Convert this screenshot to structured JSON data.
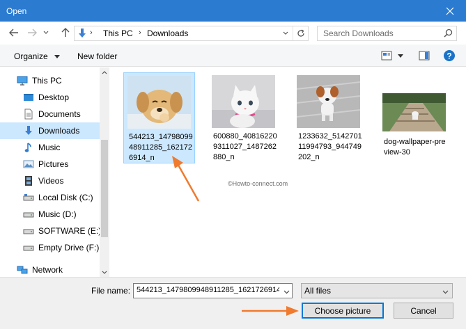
{
  "window": {
    "title": "Open"
  },
  "address": {
    "crumbs": [
      "This PC",
      "Downloads"
    ],
    "search_placeholder": "Search Downloads"
  },
  "toolbar": {
    "organize": "Organize",
    "new_folder": "New folder"
  },
  "nav": {
    "items": [
      {
        "label": "This PC",
        "icon": "monitor-icon",
        "selected": false
      },
      {
        "label": "Desktop",
        "icon": "desktop-folder-icon",
        "selected": false
      },
      {
        "label": "Documents",
        "icon": "documents-icon",
        "selected": false
      },
      {
        "label": "Downloads",
        "icon": "download-arrow-icon",
        "selected": true
      },
      {
        "label": "Music",
        "icon": "music-note-icon",
        "selected": false
      },
      {
        "label": "Pictures",
        "icon": "pictures-icon",
        "selected": false
      },
      {
        "label": "Videos",
        "icon": "film-icon",
        "selected": false
      },
      {
        "label": "Local Disk (C:)",
        "icon": "drive-icon",
        "selected": false
      },
      {
        "label": "Music (D:)",
        "icon": "drive-icon",
        "selected": false
      },
      {
        "label": "SOFTWARE (E:)",
        "icon": "drive-icon",
        "selected": false
      },
      {
        "label": "Empty Drive (F:)",
        "icon": "drive-icon",
        "selected": false
      },
      {
        "label": "Network",
        "icon": "network-icon",
        "selected": false
      }
    ]
  },
  "files": [
    {
      "name": "544213_1479809948911285_1621726914_n",
      "thumb": "puppy-laughing",
      "selected": true
    },
    {
      "name": "600880_408162209311027_1487262880_n",
      "thumb": "white-kitten",
      "selected": false
    },
    {
      "name": "1233632_514270111994793_944749202_n",
      "thumb": "puppy-on-floor",
      "selected": false
    },
    {
      "name": "dog-wallpaper-preview-30",
      "thumb": "dog-on-path",
      "selected": false
    }
  ],
  "watermark": "©Howto-connect.com",
  "footer": {
    "file_name_label": "File name:",
    "file_name_value": "544213_1479809948911285_1621726914_",
    "filter_value": "All files",
    "choose_label": "Choose picture",
    "cancel_label": "Cancel"
  },
  "colors": {
    "titlebar": "#2b7bd0",
    "selection": "#cce8ff",
    "accent": "#0078d7",
    "annotation_arrow": "#f07a2e"
  }
}
